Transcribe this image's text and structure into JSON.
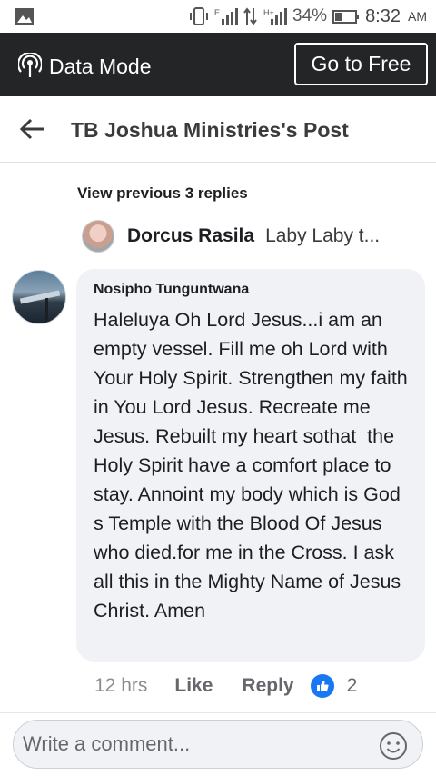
{
  "status_bar": {
    "battery": "34%",
    "time": "8:32",
    "ampm": "AM",
    "net1": "E",
    "net2": "H+"
  },
  "data_mode": {
    "label": "Data Mode",
    "button": "Go to Free",
    "icon": "broadcast-icon"
  },
  "header": {
    "title": "TB Joshua Ministries's Post",
    "back_icon": "back-arrow-icon"
  },
  "thread": {
    "view_previous": "View previous 3 replies",
    "reply_preview": {
      "name": "Dorcus Rasila",
      "text": "Laby Laby t..."
    },
    "comment": {
      "author": "Nosipho Tunguntwana",
      "text": "Haleluya Oh Lord Jesus...i am an empty vessel. Fill me oh Lord with Your Holy Spirit. Strengthen my faith in You Lord Jesus. Recreate me Jesus. Rebuilt my heart sothat  the Holy Spirit have a comfort place to stay. Annoint my body which is God s Temple with the Blood Of Jesus who died.for me in the Cross. I ask all this in the Mighty Name of Jesus Christ. Amen",
      "time": "12 hrs",
      "like_label": "Like",
      "reply_label": "Reply",
      "like_count": "2"
    }
  },
  "composer": {
    "placeholder": "Write a comment...",
    "emoji_icon": "smiley-icon"
  },
  "colors": {
    "data_bar": "#242526",
    "bubble": "#f0f2f5",
    "like_blue": "#1877f2"
  }
}
